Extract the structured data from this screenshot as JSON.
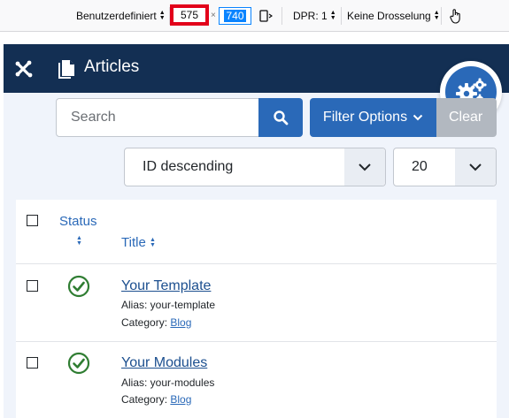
{
  "devtools": {
    "device_label": "Benutzerdefiniert",
    "width_value": "575",
    "dim_separator": "×",
    "height_value": "740",
    "dpr_label": "DPR: 1",
    "throttle_label": "Keine Drosselung"
  },
  "header": {
    "title": "Articles"
  },
  "search": {
    "placeholder": "Search",
    "filter_options_label": "Filter Options",
    "clear_label": "Clear"
  },
  "sort": {
    "order_value": "ID descending",
    "limit_value": "20"
  },
  "table": {
    "headers": {
      "status": "Status",
      "title": "Title"
    },
    "rows": [
      {
        "title": "Your Template",
        "alias": "Alias: your-template",
        "category_label": "Category:",
        "category": "Blog"
      },
      {
        "title": "Your Modules",
        "alias": "Alias: your-modules",
        "category_label": "Category:",
        "category": "Blog"
      }
    ]
  },
  "colors": {
    "header_bg": "#132f53",
    "primary": "#2a69b8",
    "published": "#2f7d32",
    "highlight": "#e2001a"
  }
}
